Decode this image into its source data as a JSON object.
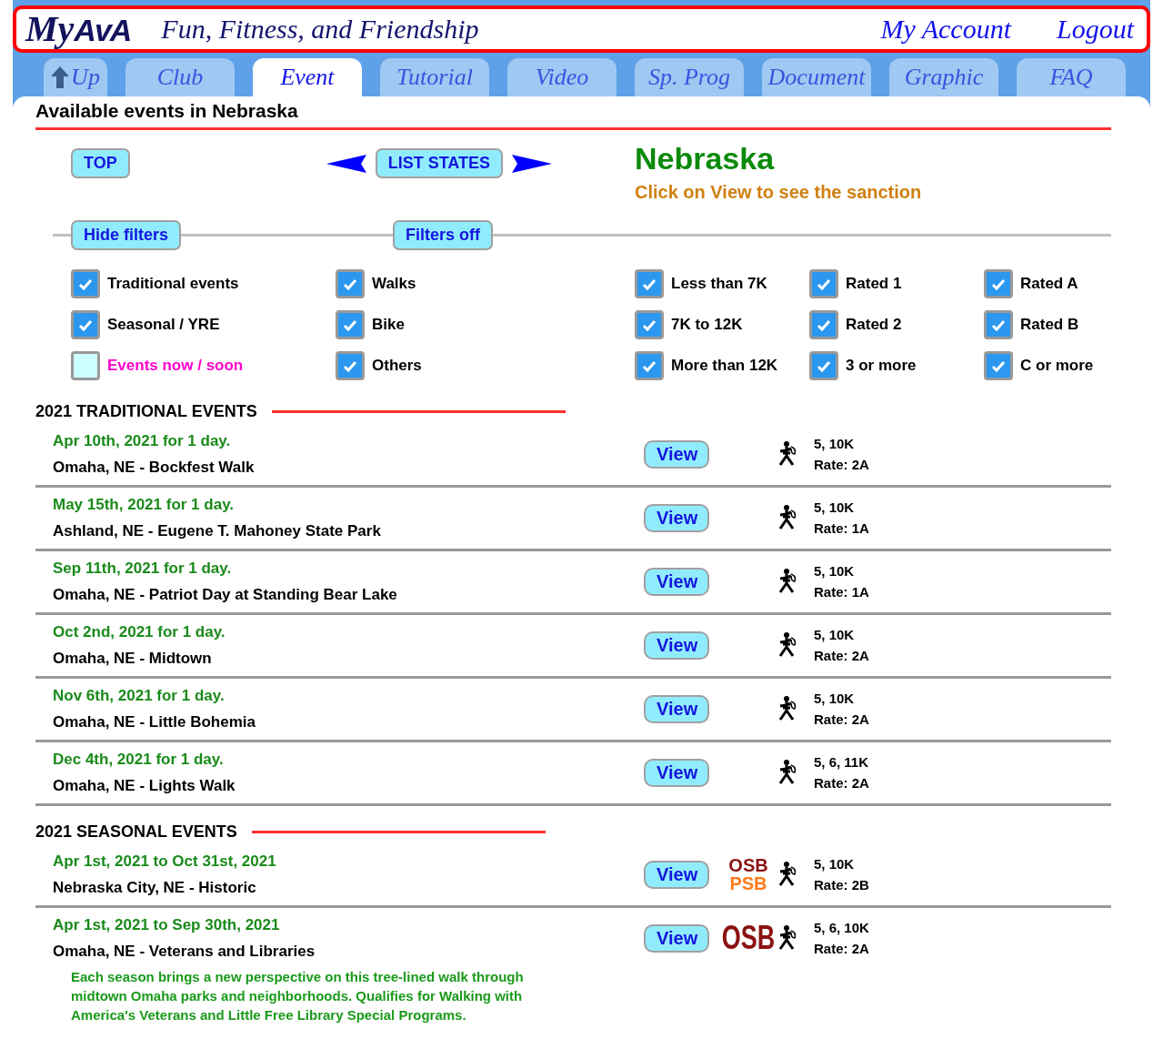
{
  "header": {
    "logo": {
      "part_1": "My",
      "part_2": "AvA"
    },
    "tagline": "Fun, Fitness, and Friendship",
    "links": [
      "My Account",
      "Logout"
    ]
  },
  "tabs": [
    {
      "label": "Up",
      "kind": "up",
      "selected": false
    },
    {
      "label": "Club",
      "kind": "plain",
      "selected": false
    },
    {
      "label": "Event",
      "kind": "plain",
      "selected": true
    },
    {
      "label": "Tutorial",
      "kind": "plain",
      "selected": false
    },
    {
      "label": "Video",
      "kind": "plain",
      "selected": false
    },
    {
      "label": "Sp. Prog",
      "kind": "plain",
      "selected": false
    },
    {
      "label": "Document",
      "kind": "plain",
      "selected": false
    },
    {
      "label": "Graphic",
      "kind": "plain",
      "selected": false
    },
    {
      "label": "FAQ",
      "kind": "plain",
      "selected": false
    }
  ],
  "page_title": "Available events in Nebraska",
  "nav": {
    "top_button": "TOP",
    "list_states_button": "LIST STATES"
  },
  "state": {
    "name": "Nebraska",
    "hint": "Click on View to see the sanction"
  },
  "filter_buttons": [
    "Hide filters",
    "Filters off"
  ],
  "filter_rows": [
    [
      {
        "label": "Traditional events",
        "checked": true
      },
      {
        "label": "Walks",
        "checked": true
      },
      {
        "label": "Less than 7K",
        "checked": true
      },
      {
        "label": "Rated 1",
        "checked": true
      },
      {
        "label": "Rated A",
        "checked": true
      }
    ],
    [
      {
        "label": "Seasonal / YRE",
        "checked": true
      },
      {
        "label": "Bike",
        "checked": true
      },
      {
        "label": "7K to 12K",
        "checked": true
      },
      {
        "label": "Rated 2",
        "checked": true
      },
      {
        "label": "Rated B",
        "checked": true
      }
    ],
    [
      {
        "label": "Events now / soon",
        "checked": false,
        "color": "#ff00cc"
      },
      {
        "label": "Others",
        "checked": true
      },
      {
        "label": "More than 12K",
        "checked": true
      },
      {
        "label": "3 or more",
        "checked": true
      },
      {
        "label": "C or more",
        "checked": true
      }
    ]
  ],
  "sections": [
    {
      "title": "2021 TRADITIONAL EVENTS",
      "events": [
        {
          "date": "Apr 10th, 2021 for 1 day.",
          "name": "Omaha, NE - Bockfest Walk",
          "button": "View",
          "distances": "5, 10K",
          "rate": "Rate: 2A"
        },
        {
          "date": "May 15th, 2021 for 1 day.",
          "name": "Ashland, NE - Eugene T. Mahoney State Park",
          "button": "View",
          "distances": "5, 10K",
          "rate": "Rate: 1A"
        },
        {
          "date": "Sep 11th, 2021 for 1 day.",
          "name": "Omaha, NE - Patriot Day at Standing Bear Lake",
          "button": "View",
          "distances": "5, 10K",
          "rate": "Rate: 1A"
        },
        {
          "date": "Oct 2nd, 2021 for 1 day.",
          "name": "Omaha, NE - Midtown",
          "button": "View",
          "distances": "5, 10K",
          "rate": "Rate: 2A"
        },
        {
          "date": "Nov 6th, 2021 for 1 day.",
          "name": "Omaha, NE - Little Bohemia",
          "button": "View",
          "distances": "5, 10K",
          "rate": "Rate: 2A"
        },
        {
          "date": "Dec 4th, 2021 for 1 day.",
          "name": "Omaha, NE - Lights Walk",
          "button": "View",
          "distances": "5, 6, 11K",
          "rate": "Rate: 2A"
        }
      ]
    },
    {
      "title": "2021 SEASONAL EVENTS",
      "events": [
        {
          "date": "Apr 1st, 2021 to Oct 31st, 2021",
          "name": "Nebraska City, NE - Historic",
          "button": "View",
          "badges": [
            {
              "text": "OSB",
              "kind": "osb"
            },
            {
              "text": "PSB",
              "kind": "psb"
            }
          ],
          "distances": "5, 10K",
          "rate": "Rate: 2B"
        },
        {
          "date": "Apr 1st, 2021 to Sep 30th, 2021",
          "name": "Omaha, NE - Veterans and Libraries",
          "button": "View",
          "badges": [
            {
              "text": "OSB",
              "kind": "osb_large"
            }
          ],
          "distances": "5, 6, 10K",
          "rate": "Rate: 2A",
          "description": "Each season brings a new perspective on this tree-lined walk through midtown Omaha parks and neighborhoods. Qualifies for Walking with America's Veterans and Little Free Library Special Programs."
        }
      ]
    }
  ]
}
